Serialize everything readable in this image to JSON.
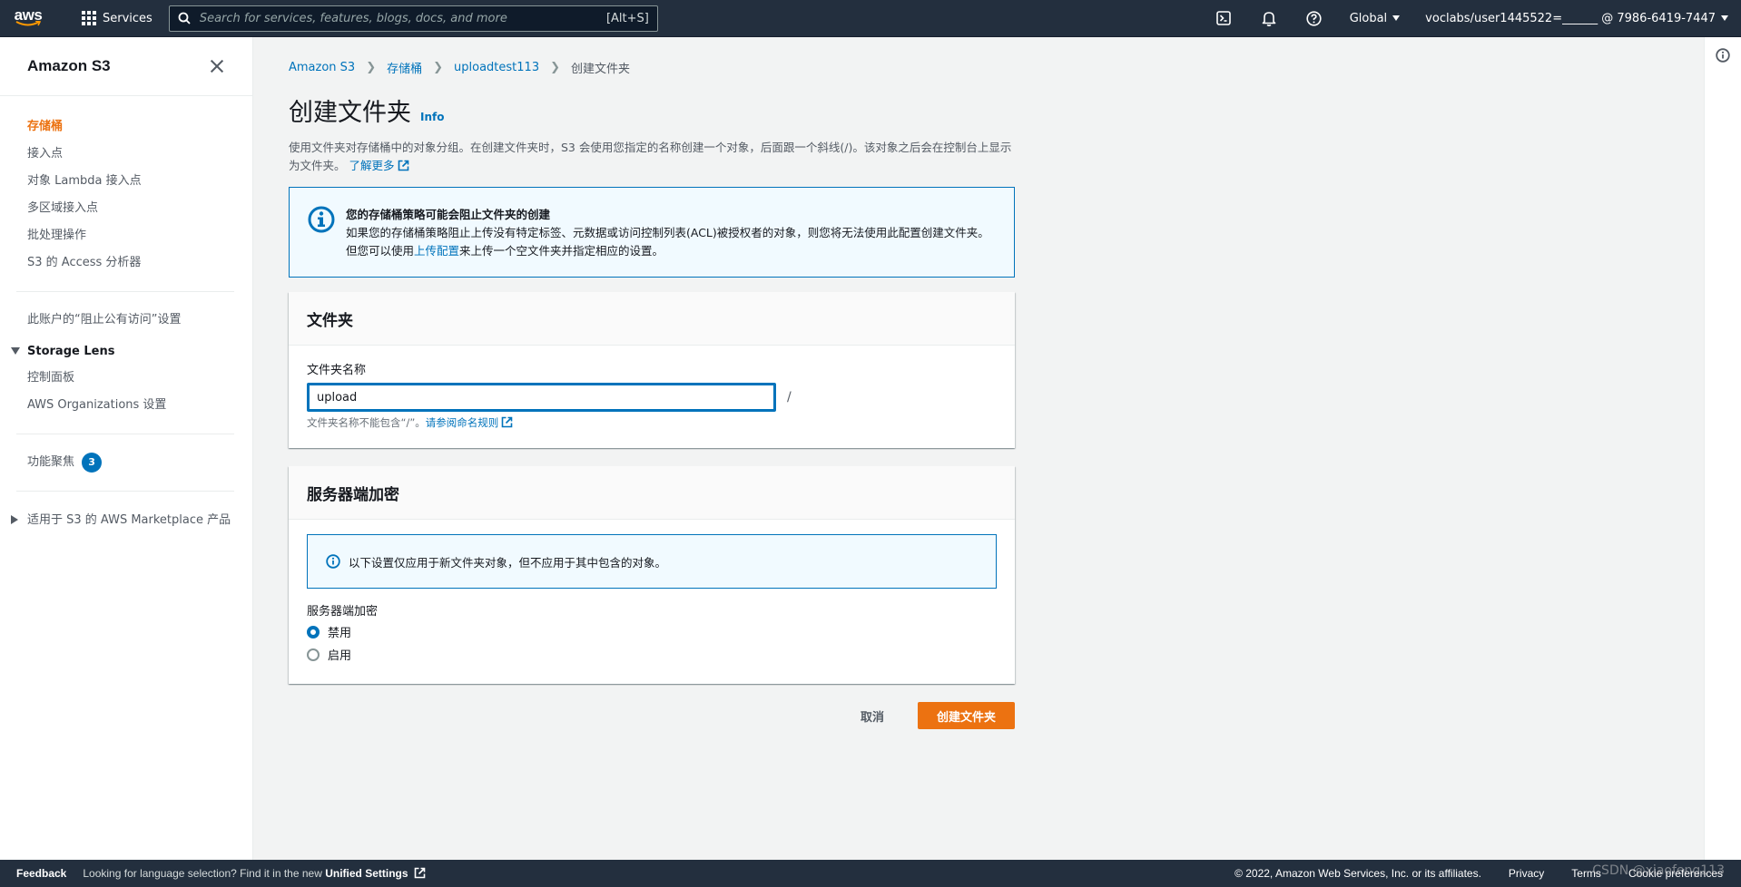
{
  "topnav": {
    "logo_text": "aws",
    "services_label": "Services",
    "search_placeholder": "Search for services, features, blogs, docs, and more",
    "search_shortcut": "[Alt+S]",
    "region": "Global",
    "account": "voclabs/user1445522=______ @ 7986-6419-7447"
  },
  "sidebar": {
    "title": "Amazon S3",
    "items": [
      {
        "label": "存储桶"
      },
      {
        "label": "接入点"
      },
      {
        "label": "对象 Lambda 接入点"
      },
      {
        "label": "多区域接入点"
      },
      {
        "label": "批处理操作"
      },
      {
        "label": "S3 的 Access 分析器"
      }
    ],
    "block_public": "此账户的“阻止公有访问”设置",
    "storage_lens": {
      "title": "Storage Lens",
      "items": [
        "控制面板",
        "AWS Organizations 设置"
      ]
    },
    "feature_spotlight": {
      "label": "功能聚焦",
      "badge": "3"
    },
    "marketplace": "适用于 S3 的 AWS Marketplace 产品"
  },
  "breadcrumb": [
    "Amazon S3",
    "存储桶",
    "uploadtest113",
    "创建文件夹"
  ],
  "page": {
    "title": "创建文件夹",
    "info_link": "Info",
    "description": "使用文件夹对存储桶中的对象分组。在创建文件夹时，S3 会使用您指定的名称创建一个对象，后面跟一个斜线(/)。该对象之后会在控制台上显示为文件夹。",
    "learn_more": "了解更多"
  },
  "alert": {
    "title": "您的存储桶策略可能会阻止文件夹的创建",
    "body_prefix": "如果您的存储桶策略阻止上传没有特定标签、元数据或访问控制列表(ACL)被授权者的对象，则您将无法使用此配置创建文件夹。但您可以使用",
    "body_link": "上传配置",
    "body_suffix": "来上传一个空文件夹并指定相应的设置。"
  },
  "folder_panel": {
    "heading": "文件夹",
    "field_label": "文件夹名称",
    "field_value": "upload",
    "slash": "/",
    "hint": "文件夹名称不能包含“/”。",
    "hint_link": "请参阅命名规则"
  },
  "encryption_panel": {
    "heading": "服务器端加密",
    "notice": "以下设置仅应用于新文件夹对象，但不应用于其中包含的对象。",
    "field_label": "服务器端加密",
    "options": [
      {
        "label": "禁用",
        "selected": true
      },
      {
        "label": "启用",
        "selected": false
      }
    ]
  },
  "actions": {
    "cancel": "取消",
    "create": "创建文件夹"
  },
  "footer": {
    "feedback": "Feedback",
    "lang_prefix": "Looking for language selection? Find it in the new",
    "lang_link": "Unified Settings",
    "copyright": "© 2022, Amazon Web Services, Inc. or its affiliates.",
    "privacy": "Privacy",
    "terms": "Terms",
    "cookies": "Cookie preferences"
  },
  "watermark": "CSDN @xiaofeng113",
  "colors": {
    "nav_bg": "#232f3e",
    "link": "#0073bb",
    "active": "#ec7211",
    "primary_button": "#ec7211"
  }
}
